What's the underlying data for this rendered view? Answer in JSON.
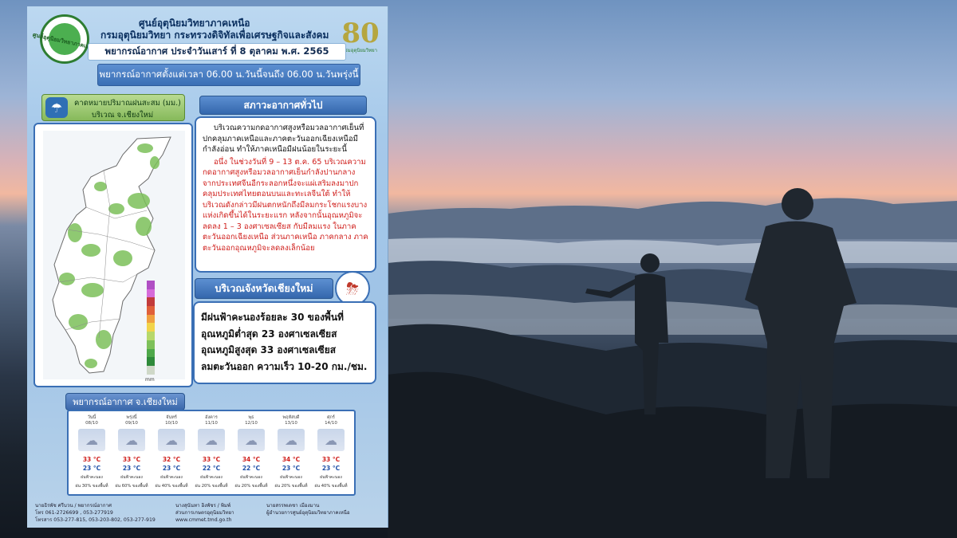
{
  "header": {
    "org_line1": "ศูนย์อุตุนิยมวิทยาภาคเหนือ",
    "org_line2": "กรมอุตุนิยมวิทยา   กระทรวงดิจิทัลเพื่อเศรษฐกิจและสังคม",
    "logo_arc_text": "ศูนย์อุตุนิยมวิทยาภาคเหนือ",
    "anniv_number": "80",
    "anniv_sub": "กรมอุตุนิยมวิทยา",
    "date_line": "พยากรณ์อากาศ ประจำวันเสาร์ ที่ 8 ตุลาคม พ.ศ. 2565",
    "period_line": "พยากรณ์อากาศตั้งแต่เวลา 06.00 น.วันนี้จนถึง 06.00 น.วันพรุ่งนี้"
  },
  "rain_map": {
    "title_line1": "คาดหมายปริมาณฝนสะสม (มม.)",
    "title_line2": "บริเวณ จ.เชียงใหม่",
    "legend_unit": "mm",
    "legend_colors": [
      "#b04fc4",
      "#d66bd9",
      "#c23b3b",
      "#e0603a",
      "#f0a040",
      "#f2d44a",
      "#b7d86a",
      "#7dc05a",
      "#4ea84a",
      "#2e8a3a",
      "#cfd8c8"
    ]
  },
  "general": {
    "heading": "สภาวะอากาศทั่วไป",
    "para_black": "บริเวณความกดอากาศสูงหรือมวลอากาศเย็นที่ปกคลุมภาคเหนือและภาคตะวันออกเฉียงเหนือมีกำลังอ่อน ทำให้ภาคเหนือมีฝนน้อยในระยะนี้",
    "para_red": "อนึ่ง ในช่วงวันที่ 9 – 13 ต.ค. 65 บริเวณความกดอากาศสูงหรือมวลอากาศเย็นกำลังปานกลางจากประเทศจีนอีกระลอกหนึ่งจะแผ่เสริมลงมาปกคลุมประเทศไทยตอนบนและทะเลจีนใต้ ทำให้บริเวณดังกล่าวมีฝนตกหนักถึงมีลมกระโชกแรงบางแห่งเกิดขึ้นได้ในระยะแรก หลังจากนั้นอุณหภูมิจะลดลง 1 – 3 องศาเซลเซียส กับมีลมแรง ในภาคตะวันออกเฉียงเหนือ ส่วนภาคเหนือ ภาคกลาง ภาคตะวันออกอุณหภูมิจะลดลงเล็กน้อย"
  },
  "chiangmai": {
    "heading": "บริเวณจังหวัดเชียงใหม่",
    "line1": "มีฝนฟ้าคะนองร้อยละ 30 ของพื้นที่",
    "line2": "อุณหภูมิต่ำสุด 23 องศาเซลเซียส",
    "line3": "อุณหภูมิสูงสุด 33 องศาเซลเซียส",
    "line4": "ลมตะวันออก ความเร็ว 10-20 กม./ชม."
  },
  "forecast": {
    "heading": "พยากรณ์อากาศ จ.เชียงใหม่",
    "days": [
      {
        "day": "วันนี้",
        "date": "08/10",
        "hi": "33 °C",
        "lo": "23 °C",
        "cond": "ฝนฟ้าคะนอง",
        "pct": "ฝน 30% ของพื้นที่"
      },
      {
        "day": "พรุ่งนี้",
        "date": "09/10",
        "hi": "33 °C",
        "lo": "23 °C",
        "cond": "ฝนฟ้าคะนอง",
        "pct": "ฝน 60% ของพื้นที่"
      },
      {
        "day": "จันทร์",
        "date": "10/10",
        "hi": "32 °C",
        "lo": "23 °C",
        "cond": "ฝนฟ้าคะนอง",
        "pct": "ฝน 40% ของพื้นที่"
      },
      {
        "day": "อังคาร",
        "date": "11/10",
        "hi": "33 °C",
        "lo": "22 °C",
        "cond": "ฝนฟ้าคะนอง",
        "pct": "ฝน 20% ของพื้นที่"
      },
      {
        "day": "พุธ",
        "date": "12/10",
        "hi": "34 °C",
        "lo": "22 °C",
        "cond": "ฝนฟ้าคะนอง",
        "pct": "ฝน 20% ของพื้นที่"
      },
      {
        "day": "พฤหัสบดี",
        "date": "13/10",
        "hi": "34 °C",
        "lo": "23 °C",
        "cond": "ฝนฟ้าคะนอง",
        "pct": "ฝน 20% ของพื้นที่"
      },
      {
        "day": "ศุกร์",
        "date": "14/10",
        "hi": "33 °C",
        "lo": "23 °C",
        "cond": "ฝนฟ้าคะนอง",
        "pct": "ฝน 40% ของพื้นที่"
      }
    ]
  },
  "footer": {
    "col1_l1": "นายธิรพัช ศรีบวน / พยากรณ์อากาศ",
    "col1_l2": "โทร 061-2726699 , 053-277919",
    "col1_l3": "โทรสาร 053-277-815, 053-203-802, 053-277-919",
    "col2_l1": "นางสุนันทา อิงพัชร / พิมพ์",
    "col2_l2": "ส่วนการเกษตรอุตุนิยมวิทยา",
    "col2_l3": "www.cmmet.tmd.go.th",
    "col3_l1": "นายสรรพเดชา เมืองมาน",
    "col3_l2": "ผู้อำนวยการศูนย์อุตุนิยมวิทยาภาคเหนือ"
  }
}
